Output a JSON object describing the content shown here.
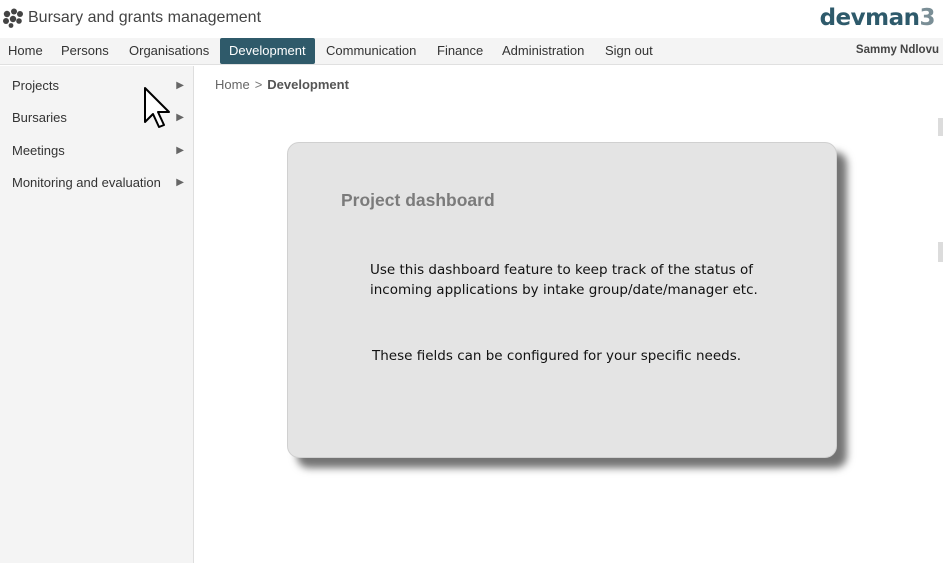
{
  "app": {
    "title": "Bursary and grants management",
    "brand_main": "devman",
    "brand_suffix": "3"
  },
  "nav": {
    "items": [
      "Home",
      "Persons",
      "Organisations",
      "Development",
      "Communication",
      "Finance",
      "Administration",
      "Sign out"
    ],
    "active": "Development",
    "user": "Sammy Ndlovu"
  },
  "sidebar": {
    "items": [
      {
        "label": "Projects"
      },
      {
        "label": "Bursaries"
      },
      {
        "label": "Meetings"
      },
      {
        "label": "Monitoring and evaluation"
      }
    ]
  },
  "breadcrumb": {
    "home": "Home",
    "separator": ">",
    "current": "Development"
  },
  "card": {
    "title": "Project dashboard",
    "line1": "Use this dashboard feature to keep track of the status of",
    "line2": "incoming  applications by intake group/date/manager etc.",
    "line3": "These fields can be configured for your specific needs."
  },
  "colors": {
    "accent": "#2f5a6a",
    "brand_dark": "#2e5a6b",
    "brand_light": "#7a8e96"
  }
}
